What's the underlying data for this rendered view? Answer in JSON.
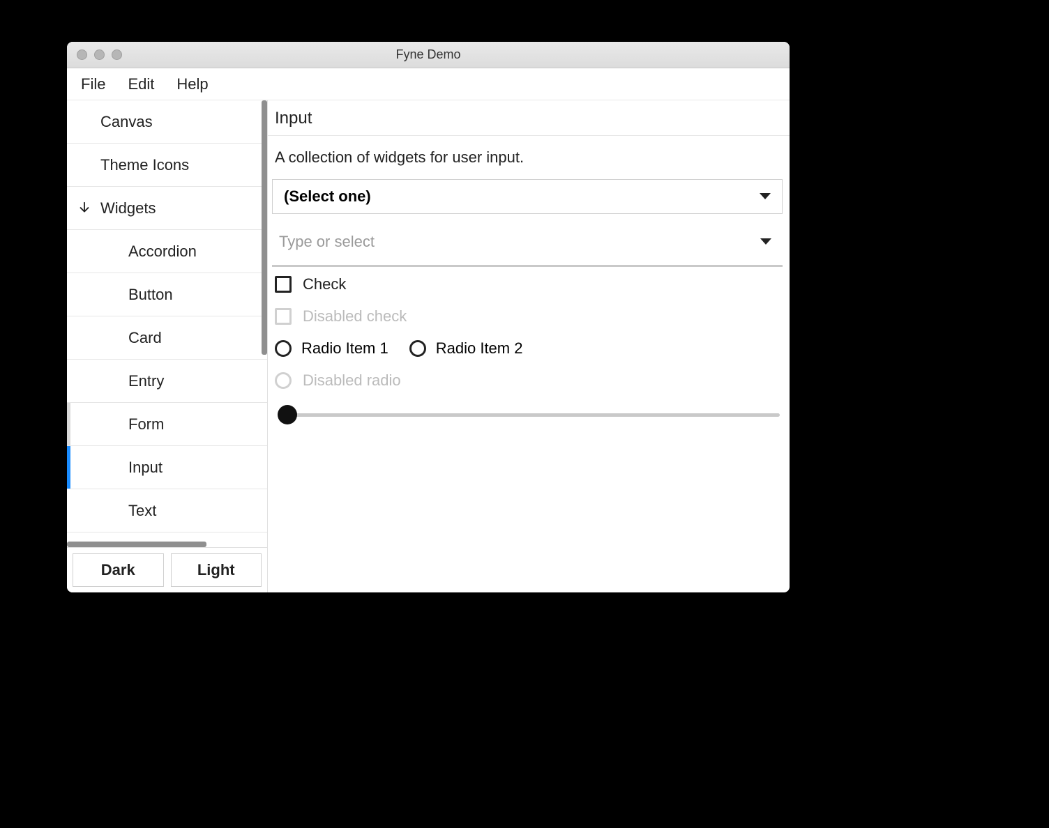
{
  "window": {
    "title": "Fyne Demo"
  },
  "menubar": {
    "items": [
      "File",
      "Edit",
      "Help"
    ]
  },
  "sidebar": {
    "items": [
      {
        "label": "Canvas",
        "level": 0
      },
      {
        "label": "Theme Icons",
        "level": 0
      },
      {
        "label": "Widgets",
        "level": 0,
        "expanded": true,
        "group": true
      },
      {
        "label": "Accordion",
        "level": 1
      },
      {
        "label": "Button",
        "level": 1
      },
      {
        "label": "Card",
        "level": 1
      },
      {
        "label": "Entry",
        "level": 1
      },
      {
        "label": "Form",
        "level": 1,
        "hover": true
      },
      {
        "label": "Input",
        "level": 1,
        "selected": true
      },
      {
        "label": "Text",
        "level": 1
      }
    ],
    "theme_buttons": {
      "dark": "Dark",
      "light": "Light"
    }
  },
  "main": {
    "title": "Input",
    "description": "A collection of widgets for user input.",
    "select": {
      "placeholder": "(Select one)"
    },
    "combo": {
      "placeholder": "Type or select"
    },
    "checks": {
      "normal": "Check",
      "disabled": "Disabled check"
    },
    "radios": {
      "items": [
        "Radio Item 1",
        "Radio Item 2"
      ],
      "disabled": "Disabled radio"
    },
    "slider": {
      "value": 0
    }
  }
}
